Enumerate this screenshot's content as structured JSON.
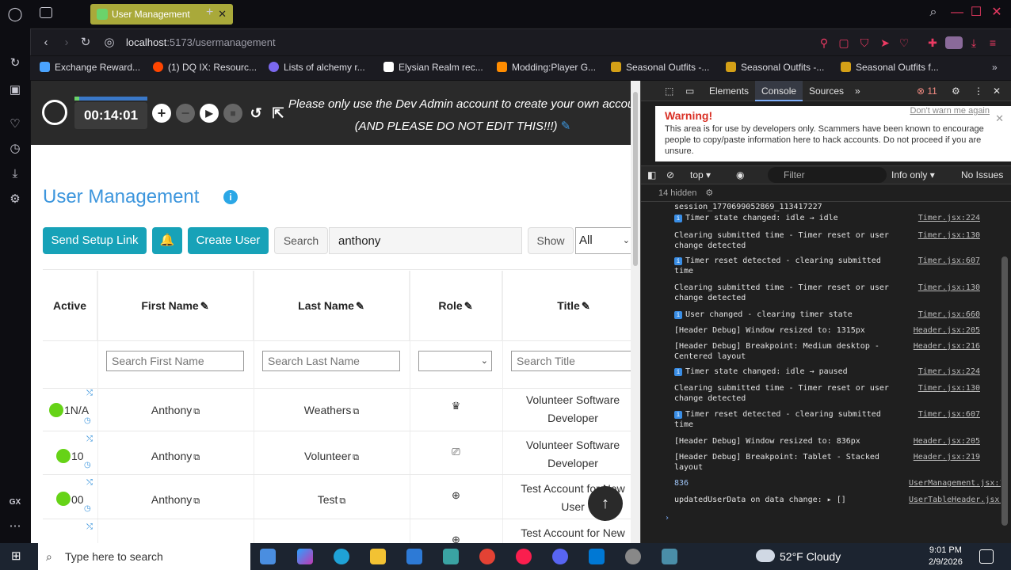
{
  "browser": {
    "tab_title": "User Management",
    "new_tab": "+",
    "url_host": "localhost",
    "url_path": ":5173/usermanagement",
    "bookmarks": [
      {
        "label": "Exchange Reward...",
        "color": "#4aa3ff"
      },
      {
        "label": "(1) DQ IX: Resourc...",
        "color": "#ff4500"
      },
      {
        "label": "Lists of alchemy r...",
        "color": "#7b68ee"
      },
      {
        "label": "Elysian Realm rec...",
        "color": "#ffffff"
      },
      {
        "label": "Modding:Player G...",
        "color": "#ff8c00"
      },
      {
        "label": "Seasonal Outfits -...",
        "color": "#d4a017"
      },
      {
        "label": "Seasonal Outfits -...",
        "color": "#d4a017"
      },
      {
        "label": "Seasonal Outfits f...",
        "color": "#d4a017"
      }
    ],
    "gx_label": "GX"
  },
  "banner": {
    "timer": "00:14:01",
    "timer_progress": 0.06,
    "message_line1": "Please only use the Dev Admin account to create your own account",
    "message_line2": "(AND PLEASE DO NOT EDIT THIS!!!)"
  },
  "page": {
    "title": "User Management",
    "send_setup_link": "Send Setup Link",
    "create_user": "Create User",
    "search_label": "Search",
    "search_value": "anthony",
    "show_label": "Show",
    "show_value": "All"
  },
  "table": {
    "headers": [
      "Active",
      "First Name",
      "Last Name",
      "Role",
      "Title"
    ],
    "filters": {
      "first_name": "Search First Name",
      "last_name": "Search Last Name",
      "title": "Search Title"
    },
    "rows": [
      {
        "active": "1N/A",
        "first": "Anthony",
        "last": "Weathers",
        "role_icon": "crown-icon",
        "title_l1": "Volunteer Software",
        "title_l2": "Developer"
      },
      {
        "active": "10",
        "first": "Anthony",
        "last": "Volunteer",
        "role_icon": "laptop-icon",
        "title_l1": "Volunteer Software",
        "title_l2": "Developer"
      },
      {
        "active": "00",
        "first": "Anthony",
        "last": "Test",
        "role_icon": "globe-icon",
        "title_l1": "Test Account for New",
        "title_l2": "User"
      },
      {
        "active": "",
        "first": "",
        "last": "",
        "role_icon": "globe-icon",
        "title_l1": "Test Account for New",
        "title_l2": ""
      }
    ]
  },
  "devtools": {
    "tabs": [
      "Elements",
      "Console",
      "Sources"
    ],
    "error_count": "11",
    "warning_title": "Warning!",
    "warning_dont": "Don't warn me again",
    "warning_body": "This area is for use by developers only. Scammers have been known to encourage people to copy/paste information here to hack accounts. Do not proceed if you are unsure.",
    "context": "top",
    "filter_placeholder": "Filter",
    "levels": "Info only",
    "issues": "No Issues",
    "hidden": "14 hidden",
    "logs": [
      {
        "text": "session_1770699052869_113417227",
        "src": "",
        "icon": false
      },
      {
        "text": "Timer state changed: idle → idle",
        "src": "Timer.jsx:224",
        "icon": true
      },
      {
        "text": "Clearing submitted time - Timer reset or user change detected",
        "src": "Timer.jsx:130",
        "icon": false
      },
      {
        "text": "Timer reset detected - clearing submitted time",
        "src": "Timer.jsx:607",
        "icon": true
      },
      {
        "text": "Clearing submitted time - Timer reset or user change detected",
        "src": "Timer.jsx:130",
        "icon": false
      },
      {
        "text": "User changed - clearing timer state",
        "src": "Timer.jsx:660",
        "icon": true
      },
      {
        "text": "[Header Debug] Window resized to: 1315px",
        "src": "Header.jsx:205",
        "icon": false
      },
      {
        "text": "[Header Debug] Breakpoint: Medium desktop - Centered layout",
        "src": "Header.jsx:216",
        "icon": false
      },
      {
        "text": "Timer state changed: idle → paused",
        "src": "Timer.jsx:224",
        "icon": true
      },
      {
        "text": "Clearing submitted time - Timer reset or user change detected",
        "src": "Timer.jsx:130",
        "icon": false
      },
      {
        "text": "Timer reset detected - clearing submitted time",
        "src": "Timer.jsx:607",
        "icon": true
      },
      {
        "text": "[Header Debug] Window resized to: 836px",
        "src": "Header.jsx:205",
        "icon": false
      },
      {
        "text": "[Header Debug] Breakpoint: Tablet - Stacked layout",
        "src": "Header.jsx:219",
        "icon": false
      },
      {
        "text": "836",
        "src": "UserManagement.jsx:112",
        "icon": false
      },
      {
        "text": "updatedUserData on data change:   ▸ []",
        "src": "UserTableHeader.jsx:34",
        "icon": false
      }
    ]
  },
  "taskbar": {
    "search_placeholder": "Type here to search",
    "weather": "52°F  Cloudy",
    "time": "9:01 PM",
    "date": "2/9/2026"
  }
}
